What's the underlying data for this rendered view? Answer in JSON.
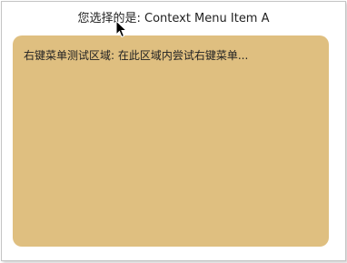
{
  "header": {
    "selection_text": "您选择的是: Context Menu Item A"
  },
  "cursor": {
    "icon": "mouse-pointer-icon"
  },
  "context_area": {
    "label": "右键菜单测试区域: 在此区域内尝试右键菜单...",
    "background_color": "#dfbf80"
  }
}
